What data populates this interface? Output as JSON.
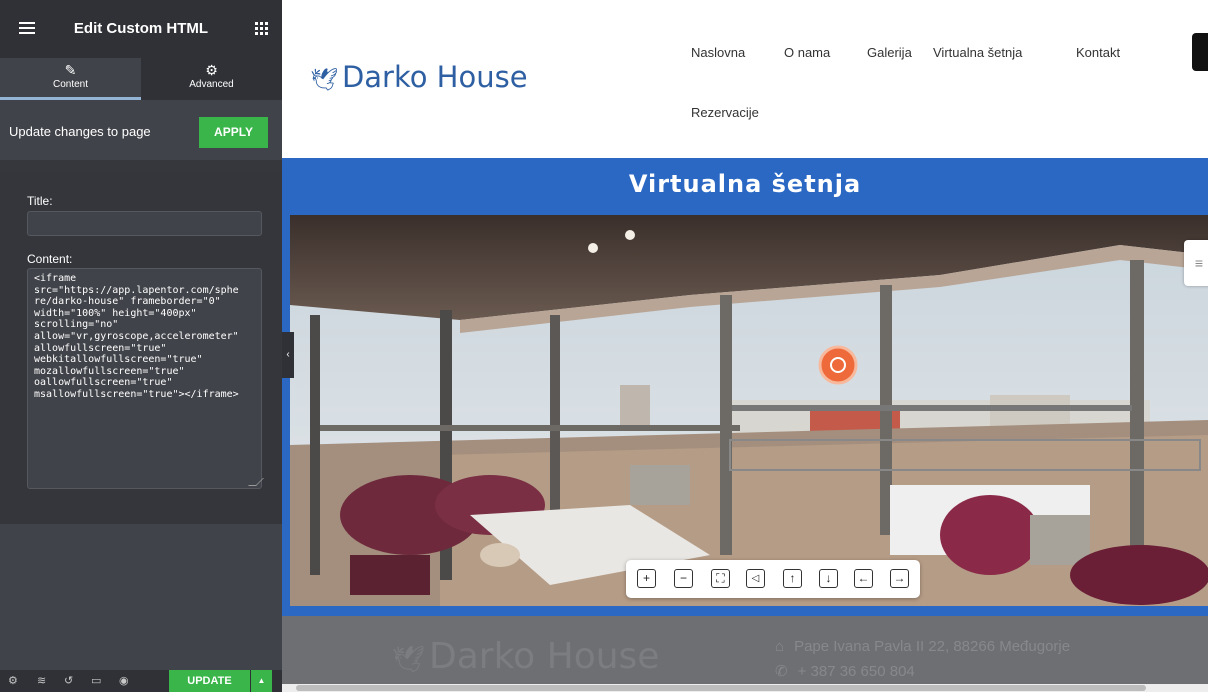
{
  "editor": {
    "title": "Edit Custom HTML",
    "tabs": [
      {
        "label": "Content",
        "icon": "pencil-icon"
      },
      {
        "label": "Advanced",
        "icon": "gear-icon"
      }
    ],
    "update_changes_label": "Update changes to page",
    "apply_label": "APPLY",
    "title_label": "Title:",
    "title_value": "",
    "content_label": "Content:",
    "content_value": "<iframe\nsrc=\"https://app.lapentor.com/sphe\nre/darko-house\" frameborder=\"0\"\nwidth=\"100%\" height=\"400px\"\nscrolling=\"no\"\nallow=\"vr,gyroscope,accelerometer\"\nallowfullscreen=\"true\"\nwebkitallowfullscreen=\"true\"\nmozallowfullscreen=\"true\"\noallowfullscreen=\"true\"\nmsallowfullscreen=\"true\"></iframe>",
    "footer": {
      "update_label": "UPDATE",
      "icons": [
        "settings-icon",
        "layers-icon",
        "history-icon",
        "responsive-icon",
        "preview-eye-icon"
      ]
    }
  },
  "site": {
    "logo": "Darko House",
    "nav": [
      "Naslovna",
      "O nama",
      "Galerija",
      "Virtualna šetnja",
      "Kontakt",
      "Rezervacije"
    ],
    "section_title": "Virtualna šetnja",
    "tour_controls": [
      "zoom-in",
      "zoom-out",
      "fullscreen",
      "sound",
      "up",
      "down",
      "left",
      "right"
    ],
    "footer": {
      "logo": "Darko House",
      "address": "Pape Ivana Pavla II 22, 88266 Međugorje",
      "phone": "+ 387 36 650 804"
    }
  },
  "colors": {
    "editor_bg": "#404349",
    "apply_green": "#39b54a",
    "brand_blue": "#2b68c4",
    "logo_blue": "#2d5fa2",
    "hotspot_orange": "#ee6a3a"
  }
}
